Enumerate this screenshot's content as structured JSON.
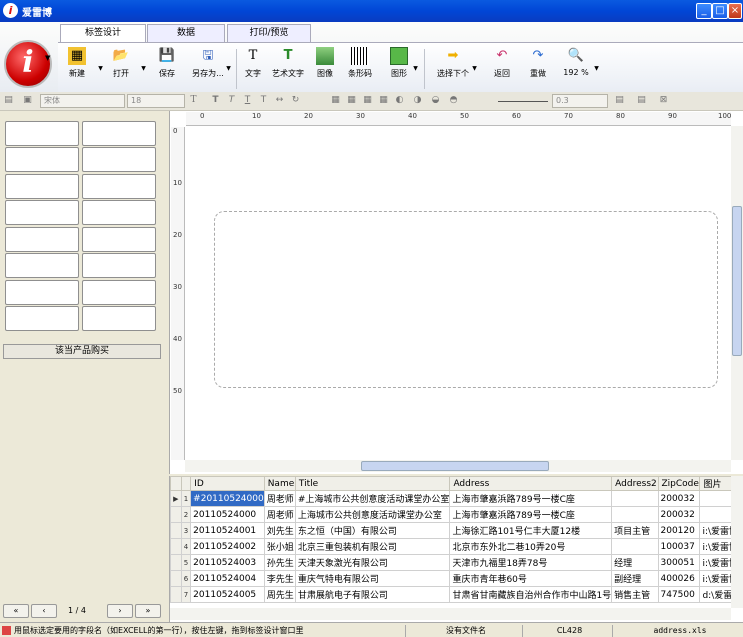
{
  "window": {
    "title": "爱雷博"
  },
  "ribbon": {
    "tabs": [
      "标签设计",
      "数据",
      "打印/预览"
    ],
    "tools": {
      "new": "新建",
      "open": "打开",
      "save": "保存",
      "save_as": "另存为...",
      "text": "文字",
      "art_text": "艺术文字",
      "image": "图像",
      "barcode": "条形码",
      "shape": "图形",
      "select_next": "选择下个",
      "undo": "返回",
      "redo": "重做",
      "zoom": "192 %"
    }
  },
  "format_bar": {
    "font_name": "宋体",
    "font_size": "18",
    "line_width": "0.3"
  },
  "left_panel": {
    "buy_button": "该当产品购买",
    "page_indicator": "1 / 4"
  },
  "ruler": {
    "h_ticks": [
      "0",
      "10",
      "20",
      "30",
      "40",
      "50",
      "60",
      "70",
      "80",
      "90",
      "100"
    ],
    "v_ticks": [
      "0",
      "10",
      "20",
      "30",
      "40",
      "50"
    ]
  },
  "table": {
    "columns": [
      "ID",
      "Name",
      "Title",
      "Address",
      "Address2",
      "ZipCode",
      "图片"
    ],
    "rows": [
      {
        "n": "1",
        "cells": [
          "#20110524000",
          "周老师",
          "#上海城市公共创意度活动课堂办公室",
          "上海市肇嘉浜路789号一楼C座",
          "",
          "200032",
          ""
        ]
      },
      {
        "n": "2",
        "cells": [
          "20110524000",
          "周老师",
          "上海城市公共创意度活动课堂办公室",
          "上海市肇嘉浜路789号一楼C座",
          "",
          "200032",
          ""
        ]
      },
      {
        "n": "3",
        "cells": [
          "20110524001",
          "刘先生",
          "东之恒（中国）有限公司",
          "上海徐汇路101号仁丰大厦12楼",
          "项目主管",
          "200120",
          "i:\\爱雷博"
        ]
      },
      {
        "n": "4",
        "cells": [
          "20110524002",
          "张小姐",
          "北京三重包装机有限公司",
          "北京市东外北二巷10弄20号",
          "",
          "100037",
          "i:\\爱雷博"
        ]
      },
      {
        "n": "5",
        "cells": [
          "20110524003",
          "孙先生",
          "天津天象激光有限公司",
          "天津市九福里18弄78号",
          "经理",
          "300051",
          "i:\\爱雷博"
        ]
      },
      {
        "n": "6",
        "cells": [
          "20110524004",
          "李先生",
          "重庆气特电有限公司",
          "重庆市青年巷60号",
          "副经理",
          "400026",
          "i:\\爱雷博"
        ]
      },
      {
        "n": "7",
        "cells": [
          "20110524005",
          "周先生",
          "甘肃展航电子有限公司",
          "甘肃省甘南藏族自治州合作市中山路1号",
          "销售主管",
          "747500",
          "d:\\爱雷博"
        ]
      }
    ]
  },
  "status": {
    "hint": "用鼠标选定要用的字段名（如EXCELL的第一行），按住左键，拖到标签设计窗口里",
    "file": "没有文件名",
    "code": "CL428",
    "source": "address.xls"
  }
}
